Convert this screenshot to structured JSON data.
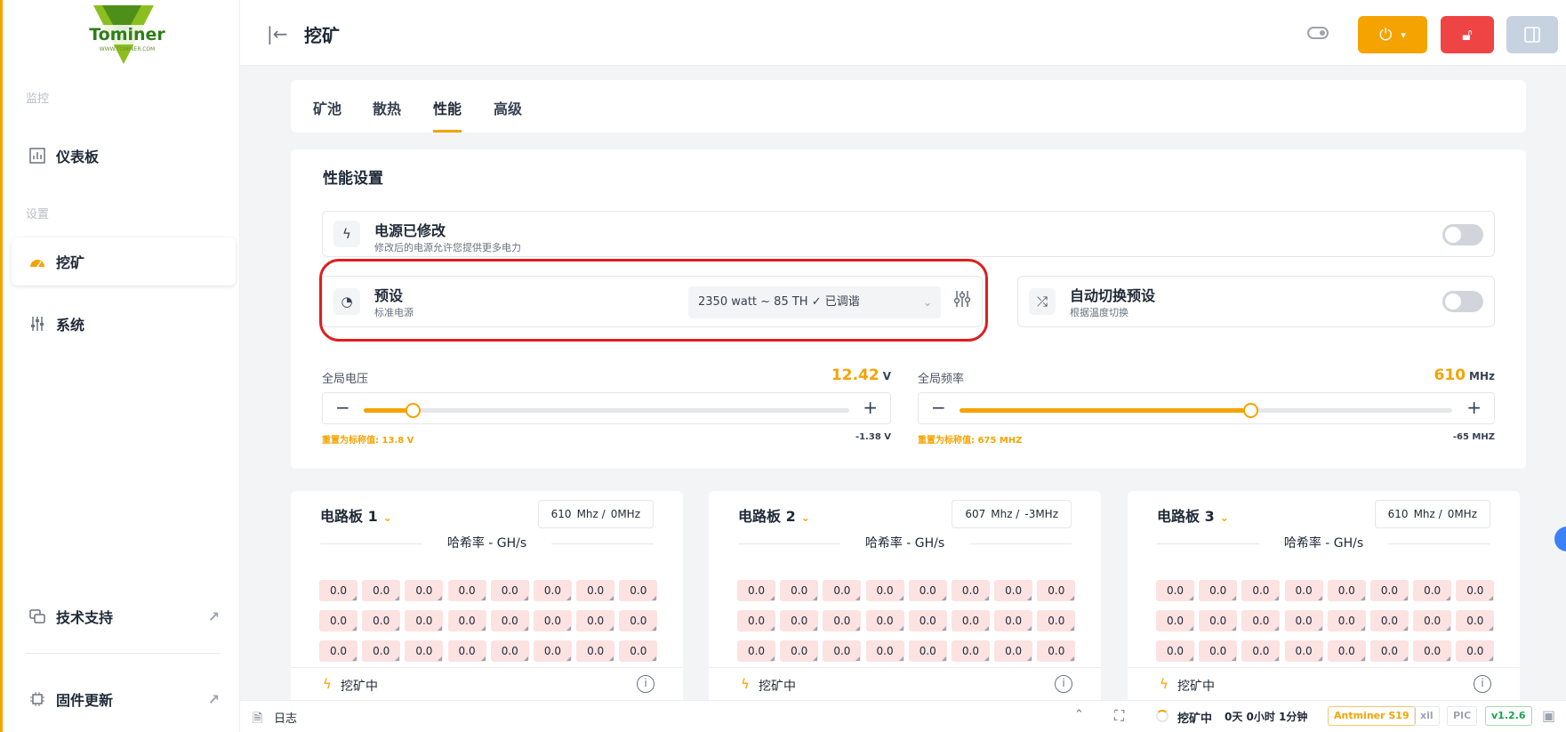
{
  "logo": {
    "brand": "Tominer",
    "sub": "WWW.TOMINER.COM"
  },
  "sidebar": {
    "section_monitor": "监控",
    "section_settings": "设置",
    "items": [
      {
        "label": "仪表板",
        "icon": "bar-chart-icon"
      },
      {
        "label": "挖矿",
        "icon": "gauge-icon"
      },
      {
        "label": "系统",
        "icon": "sliders-icon"
      },
      {
        "label": "技术支持",
        "icon": "chat-icon"
      },
      {
        "label": "固件更新",
        "icon": "chip-icon"
      }
    ]
  },
  "header": {
    "title": "挖矿"
  },
  "tabs": [
    {
      "label": "矿池"
    },
    {
      "label": "散热"
    },
    {
      "label": "性能"
    },
    {
      "label": "高级"
    }
  ],
  "performance": {
    "title": "性能设置",
    "power_modified": {
      "title": "电源已修改",
      "subtitle": "修改后的电源允许您提供更多电力"
    },
    "preset": {
      "title": "预设",
      "subtitle": "标准电源",
      "selected": "2350 watt ~ 85 TH ✓ 已调谐"
    },
    "auto_switch": {
      "title": "自动切换预设",
      "subtitle": "根据温度切换"
    },
    "voltage": {
      "label": "全局电压",
      "value": "12.42",
      "unit": "V",
      "reset_note": "重置为标称值:  13.8 V",
      "offset": "-1.38 V",
      "level": 0.1
    },
    "frequency": {
      "label": "全局频率",
      "value": "610",
      "unit": "MHz",
      "reset_note": "重置为标称值:  675 MHZ",
      "offset": "-65 MHZ",
      "level": 0.59
    }
  },
  "boards": [
    {
      "title": "电路板 1",
      "freq": "610",
      "unit": "Mhz /",
      "delta": "0MHz",
      "hash_label": "哈希率 - GH/s",
      "chip_value": "0.0",
      "status": "挖矿中"
    },
    {
      "title": "电路板 2",
      "freq": "607",
      "unit": "Mhz /",
      "delta": "-3MHz",
      "hash_label": "哈希率 - GH/s",
      "chip_value": "0.0",
      "status": "挖矿中"
    },
    {
      "title": "电路板 3",
      "freq": "610",
      "unit": "Mhz /",
      "delta": "0MHz",
      "hash_label": "哈希率 - GH/s",
      "chip_value": "0.0",
      "status": "挖矿中"
    }
  ],
  "statusbar": {
    "log": "日志",
    "state": "挖矿中",
    "uptime": "0天 0小时 1分钟",
    "model": "Antminer S19",
    "xil": "xil",
    "pic": "PIC",
    "version": "v1.2.6"
  },
  "colors": {
    "accent": "#f5a300",
    "danger": "#ef4444",
    "chip_bg": "#fde2e2"
  }
}
